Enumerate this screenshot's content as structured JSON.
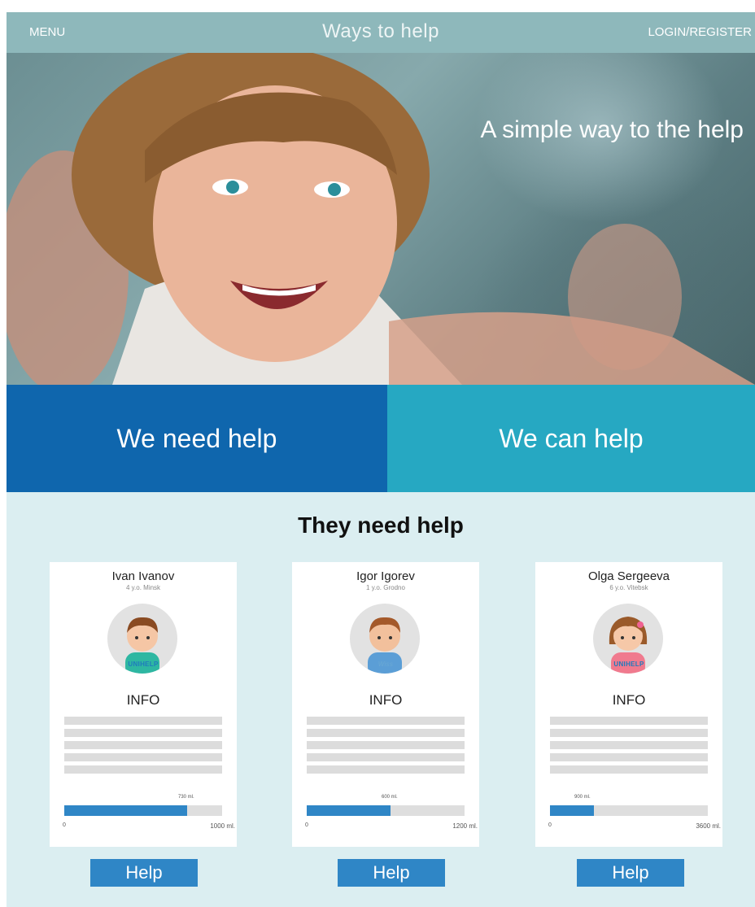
{
  "header": {
    "menu_label": "MENU",
    "title": "Ways to help",
    "login_label": "LOGIN/REGISTER"
  },
  "hero": {
    "tagline": "A simple way to the help"
  },
  "split": {
    "need_label": "We need help",
    "can_label": "We can help"
  },
  "section": {
    "title": "They need help",
    "cards": [
      {
        "name": "Ivan Ivanov",
        "sub": "4 y.o. Minsk",
        "logo": "UNIHELP",
        "info_label": "INFO",
        "current_label": "730 ml.",
        "min_label": "0",
        "max_label": "1000 ml.",
        "progress": 0.78,
        "help_label": "Help"
      },
      {
        "name": "Igor Igorev",
        "sub": "1 y.o. Grodno",
        "logo": "Wiss",
        "info_label": "INFO",
        "current_label": "600 ml.",
        "min_label": "0",
        "max_label": "1200 ml.",
        "progress": 0.53,
        "help_label": "Help"
      },
      {
        "name": "Olga Sergeeva",
        "sub": "6 y.o. Vitebsk",
        "logo": "UNIHELP",
        "info_label": "INFO",
        "current_label": "900 ml.",
        "min_label": "0",
        "max_label": "3600 ml.",
        "progress": 0.28,
        "help_label": "Help"
      }
    ]
  },
  "colors": {
    "header_bg": "#8eb8bb",
    "need_bg": "#0f66ad",
    "can_bg": "#26a8c2",
    "section_bg": "#dbeef1",
    "accent": "#2f86c6"
  }
}
